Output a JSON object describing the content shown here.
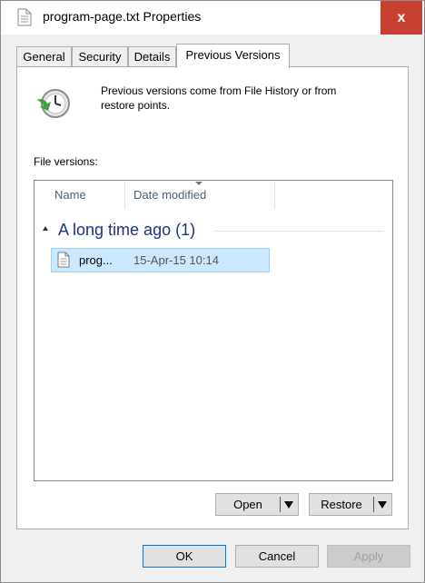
{
  "window": {
    "title": "program-page.txt Properties",
    "close_glyph": "x"
  },
  "tabs": [
    {
      "label": "General"
    },
    {
      "label": "Security"
    },
    {
      "label": "Details"
    },
    {
      "label": "Previous Versions",
      "active": true
    }
  ],
  "info": {
    "text": "Previous versions come from File History or from restore points.",
    "icon": "history-clock-icon"
  },
  "file_versions": {
    "label": "File versions:",
    "columns": [
      "Name",
      "Date modified"
    ],
    "group": {
      "label": "A long time ago (1)",
      "rows": [
        {
          "name": "prog...",
          "date": "15-Apr-15 10:14"
        }
      ]
    }
  },
  "actions": {
    "open_label": "Open",
    "restore_label": "Restore"
  },
  "footer": {
    "ok_label": "OK",
    "cancel_label": "Cancel",
    "apply_label": "Apply"
  },
  "colors": {
    "close_button": "#c84031",
    "selection": "#cce8ff",
    "group_text": "#1e3287"
  }
}
